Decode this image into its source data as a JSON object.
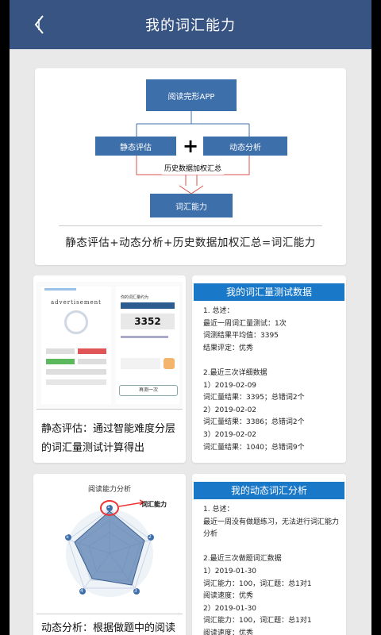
{
  "header": {
    "title": "我的词汇能力"
  },
  "diagram": {
    "top_box": "阅读完形APP",
    "left_box": "静态评估",
    "plus": "+",
    "right_box": "动态分析",
    "middle_label": "历史数据加权汇总",
    "bottom_box": "词汇能力",
    "formula": "静态评估+动态分析+历史数据加权汇总=词汇能力",
    "colors": {
      "box": "#3d6fab",
      "arrow_line": "#d9534f"
    }
  },
  "static_card": {
    "mock": {
      "advert": "advertisement",
      "vocab_title": "你的词汇量约为",
      "score": "3352",
      "retest_button": "再测一次"
    },
    "caption_line1": "静态评估：通过智能难度分层",
    "caption_line2": "的词汇量测试计算得出"
  },
  "test_panel": {
    "title": "我的词汇量测试数据",
    "lines": [
      "1. 总述：",
      "最近一周词汇量测试：1次",
      "词测结果平均值：3395",
      "结果评定：优秀",
      "",
      "2.最近三次详细数据",
      "1）2019-02-09",
      "词汇量结果：3395；总错词2个",
      "2）2019-02-02",
      "词汇量结果：3386；总错词2个",
      "3）2019-02-02",
      "词汇量结果：1040；总错词9个"
    ]
  },
  "dynamic_card": {
    "radar_title": "阅读能力分析",
    "radar_label": "词汇能力",
    "radar_nums": [
      "1",
      "2",
      "3",
      "4",
      "5"
    ],
    "caption_line1": "动态分析：根据做题中的阅读"
  },
  "dynamic_panel": {
    "title": "我的动态词汇分析",
    "lines": [
      "1. 总述：",
      "最近一周没有做题练习，无法进行词汇能力",
      "分析",
      "",
      "2.最近三次做题词汇数据",
      "1）2019-01-30",
      "词汇能力：100，词汇题：总1对1",
      "阅读速度：优秀",
      "2）2019-01-30",
      "词汇能力：100，词汇题：总1对1",
      "阅读速度：优秀"
    ]
  }
}
